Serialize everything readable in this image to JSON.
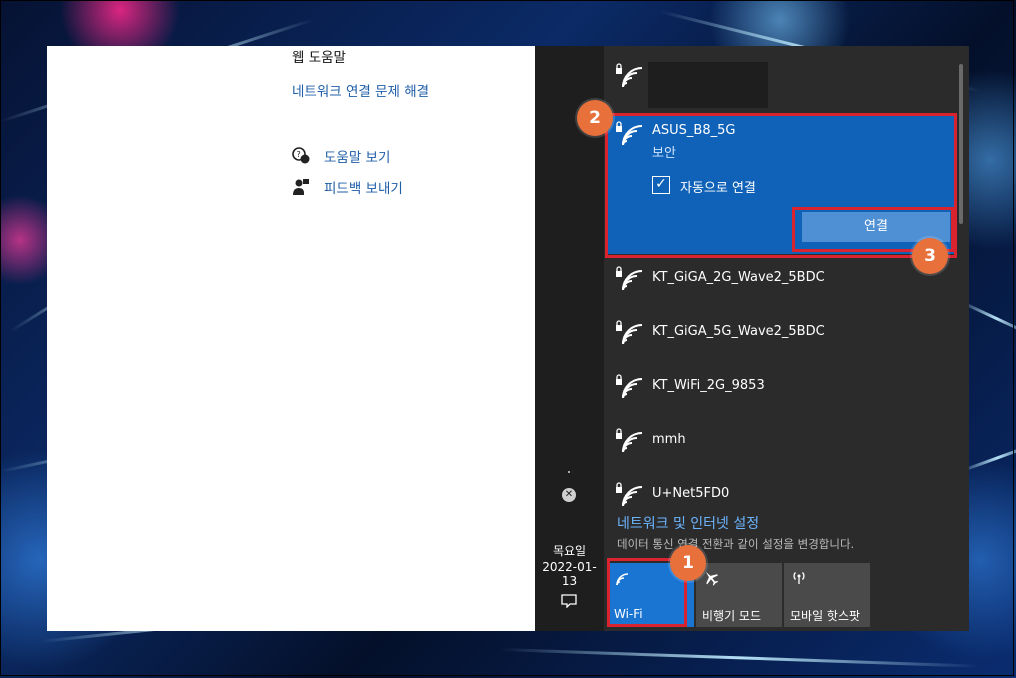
{
  "left_panel": {
    "web_help": "웹 도움말",
    "troubleshoot_link": "네트워크 연결 문제 해결",
    "help_view": "도움말 보기",
    "feedback": "피드백 보내기"
  },
  "taskbar": {
    "day": "목요일",
    "date": "2022-01-13"
  },
  "networks": {
    "selected": {
      "name": "ASUS_B8_5G",
      "security": "보안",
      "auto_connect_label": "자동으로 연결",
      "auto_connect_checked": true,
      "connect_button": "연결"
    },
    "list": [
      {
        "name": "KT_GiGA_2G_Wave2_5BDC"
      },
      {
        "name": "KT_GiGA_5G_Wave2_5BDC"
      },
      {
        "name": "KT_WiFi_2G_9853"
      },
      {
        "name": "mmh"
      },
      {
        "name": "U+Net5FD0"
      }
    ]
  },
  "settings": {
    "link": "네트워크 및 인터넷 설정",
    "description": "데이터 통신 연결 전환과 같이 설정을 변경합니다."
  },
  "quick_actions": [
    {
      "label": "Wi-Fi",
      "icon": "wifi-icon",
      "active": true
    },
    {
      "label": "비행기 모드",
      "icon": "airplane-icon",
      "active": false
    },
    {
      "label": "모바일 핫스팟",
      "icon": "hotspot-icon",
      "active": false
    }
  ],
  "annotations": [
    "1",
    "2",
    "3"
  ],
  "colors": {
    "accent": "#0f62b8",
    "highlight": "#d9242f",
    "badge": "#e8703a"
  }
}
